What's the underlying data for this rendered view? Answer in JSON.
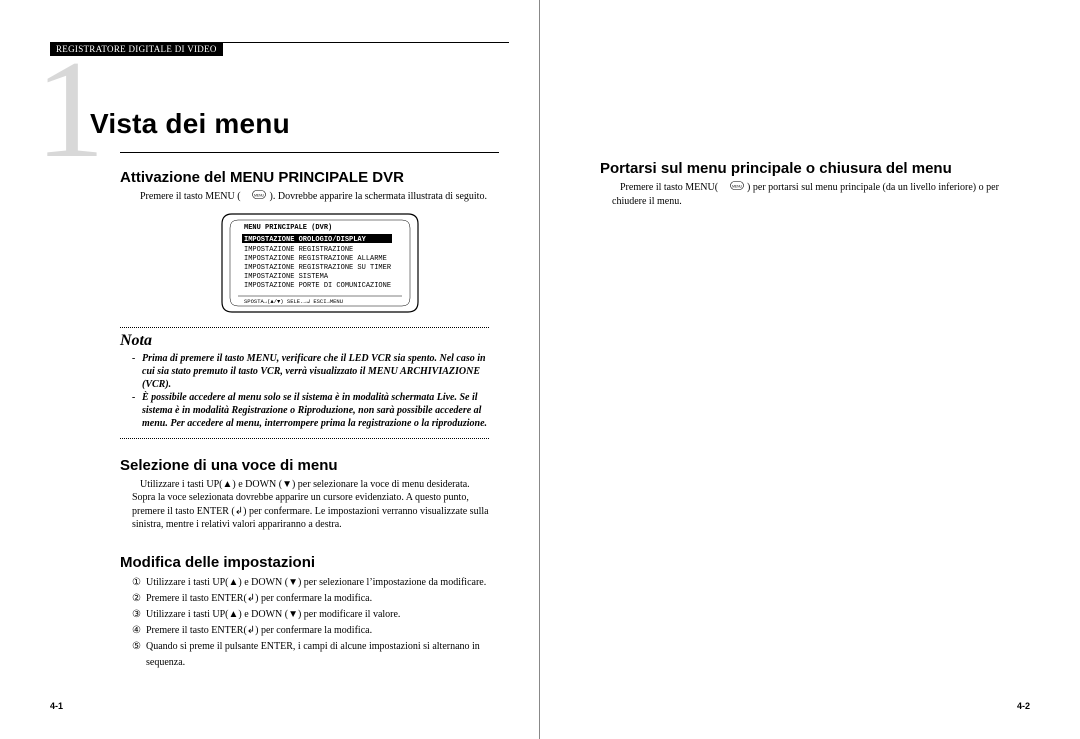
{
  "header_label": "REGISTRATORE DIGITALE DI VIDEO",
  "chapter_number_glyph": "1",
  "chapter_title": "Vista dei menu",
  "section1": {
    "heading": "Attivazione del MENU PRINCIPALE DVR",
    "body_pre": "Premere il tasto MENU (",
    "body_post": "). Dovrebbe apparire la schermata illustrata di seguito."
  },
  "menu_screen": {
    "title": "MENU PRINCIPALE (DVR)",
    "items": [
      "IMPOSTAZIONE OROLOGIO/DISPLAY",
      "IMPOSTAZIONE REGISTRAZIONE",
      "IMPOSTAZIONE REGISTRAZIONE ALLARME",
      "IMPOSTAZIONE REGISTRAZIONE SU TIMER",
      "IMPOSTAZIONE SISTEMA",
      "IMPOSTAZIONE PORTE DI COMUNICAZIONE"
    ],
    "footer": "SPOSTA→(▲/▼) SELE.→↲  ESCI→MENU"
  },
  "nota": {
    "heading": "Nota",
    "items": [
      "Prima di premere il tasto MENU, verificare che il LED VCR sia spento. Nel caso in cui sia stato premuto il tasto VCR, verrà visualizzato il MENU ARCHIVIAZIONE (VCR).",
      "È possibile accedere al menu solo se il sistema è in modalità schermata Live. Se il sistema è in modalità Registrazione o Riproduzione, non sarà possibile accedere al menu. Per accedere al menu, interrompere prima la registrazione o la riproduzione."
    ]
  },
  "section2": {
    "heading": "Selezione di una voce di menu",
    "body": "Utilizzare i tasti UP(▲) e DOWN (▼) per selezionare la voce di menu desiderata. Sopra la voce selezionata dovrebbe apparire un cursore evidenziato. A questo punto, premere il tasto ENTER (↲) per confermare. Le impostazioni verranno visualizzate sulla sinistra, mentre i relativi valori appariranno a destra."
  },
  "section3": {
    "heading": "Modifica delle impostazioni",
    "steps": [
      "Utilizzare i tasti UP(▲) e DOWN (▼) per selezionare l’impostazione da modificare.",
      "Premere il tasto ENTER(↲) per confermare la modifica.",
      "Utilizzare i tasti UP(▲) e DOWN (▼) per modificare il valore.",
      "Premere il tasto ENTER(↲) per confermare la modifica.",
      "Quando si preme il pulsante ENTER, i campi di alcune impostazioni si alternano in sequenza."
    ],
    "markers": [
      "①",
      "②",
      "③",
      "④",
      "⑤"
    ]
  },
  "right": {
    "heading": "Portarsi sul menu principale o chiusura del menu",
    "body_pre": "Premere il tasto MENU(",
    "body_post": ") per portarsi sul menu principale (da un livello inferiore) o per chiudere il menu."
  },
  "page_left": "4-1",
  "page_right": "4-2"
}
